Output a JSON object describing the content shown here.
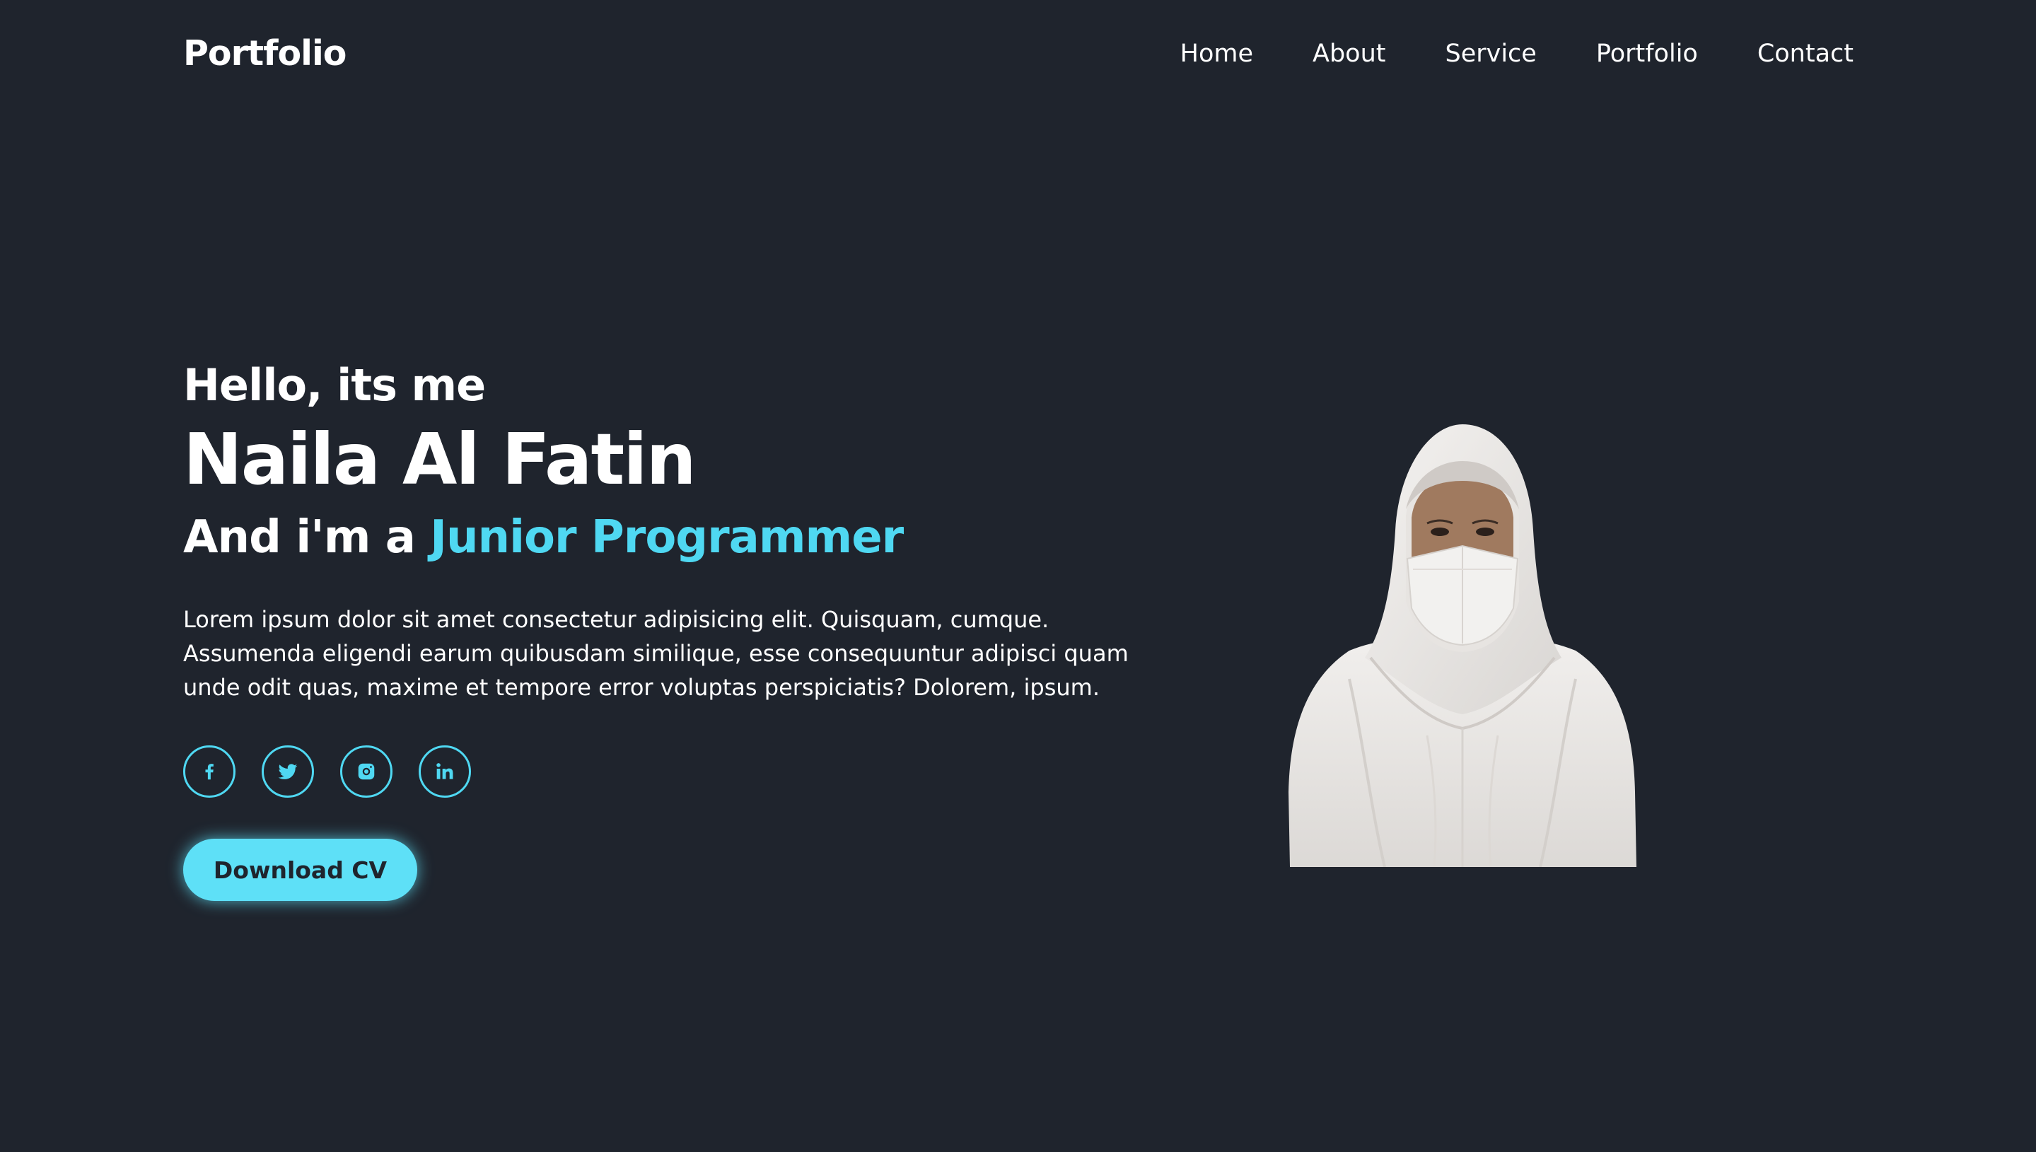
{
  "header": {
    "logo": "Portfolio",
    "nav": [
      "Home",
      "About",
      "Service",
      "Portfolio",
      "Contact"
    ]
  },
  "hero": {
    "greeting": "Hello, its me",
    "name": "Naila Al Fatin",
    "role_prefix": "And i'm a ",
    "role_highlight": "Junior Programmer",
    "intro_line1": "Lorem ipsum dolor sit amet consectetur adipisicing elit. Quisquam, cumque.",
    "intro_line2": "Assumenda eligendi earum quibusdam similique, esse consequuntur adipisci quam",
    "intro_line3": "unde odit quas, maxime et tempore error voluptas perspiciatis? Dolorem, ipsum.",
    "socials": [
      "facebook-icon",
      "twitter-icon",
      "instagram-icon",
      "linkedin-icon"
    ],
    "cta_label": "Download CV"
  },
  "colors": {
    "background": "#1f242d",
    "accent": "#4fd8f2",
    "text": "#ffffff"
  }
}
